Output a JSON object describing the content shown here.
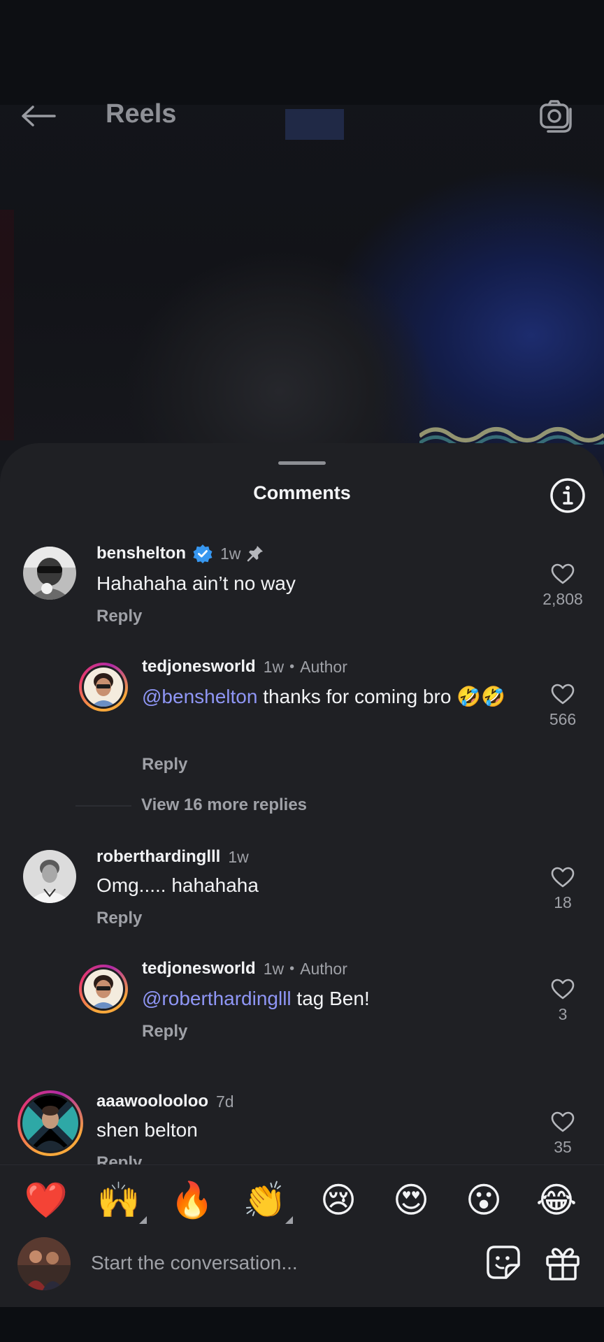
{
  "header": {
    "title": "Reels"
  },
  "sheet": {
    "title": "Comments"
  },
  "comments": [
    {
      "username": "benshelton",
      "verified": true,
      "pinned": true,
      "time": "1w",
      "text": "Hahahaha ain’t no way",
      "reply_label": "Reply",
      "likes": "2,808"
    },
    {
      "username": "tedjonesworld",
      "time": "1w",
      "author_label": "Author",
      "mention": "@benshelton",
      "text": " thanks for coming bro 🤣🤣",
      "reply_label": "Reply",
      "likes": "566"
    },
    {
      "username": "roberthardinglll",
      "time": "1w",
      "text": "Omg..... hahahaha",
      "reply_label": "Reply",
      "likes": "18"
    },
    {
      "username": "tedjonesworld",
      "time": "1w",
      "author_label": "Author",
      "mention": "@roberthardinglll",
      "text": " tag Ben!",
      "reply_label": "Reply",
      "likes": "3"
    },
    {
      "username": "aaawoolooloo",
      "time": "7d",
      "text": "shen belton",
      "reply_label": "Reply",
      "likes": "35"
    }
  ],
  "view_more_replies": "View 16 more replies",
  "emoji_bar": [
    {
      "name": "red-heart",
      "glyph": "❤️",
      "has_variants": false
    },
    {
      "name": "raising-hands",
      "glyph": "🙌",
      "has_variants": true
    },
    {
      "name": "fire",
      "glyph": "🔥",
      "has_variants": false
    },
    {
      "name": "clapping-hands",
      "glyph": "👏",
      "has_variants": true
    },
    {
      "name": "crying-face",
      "glyph": "😢",
      "has_variants": false
    },
    {
      "name": "heart-eyes",
      "glyph": "😍",
      "has_variants": false
    },
    {
      "name": "surprised-face",
      "glyph": "😮",
      "has_variants": false
    },
    {
      "name": "tears-of-joy",
      "glyph": "😂",
      "has_variants": false
    }
  ],
  "input": {
    "placeholder": "Start the conversation..."
  },
  "colors": {
    "sheet_bg": "#1f2024",
    "mention": "#8f96f5",
    "verified": "#3797f0",
    "muted_text": "#9fa1a7"
  }
}
